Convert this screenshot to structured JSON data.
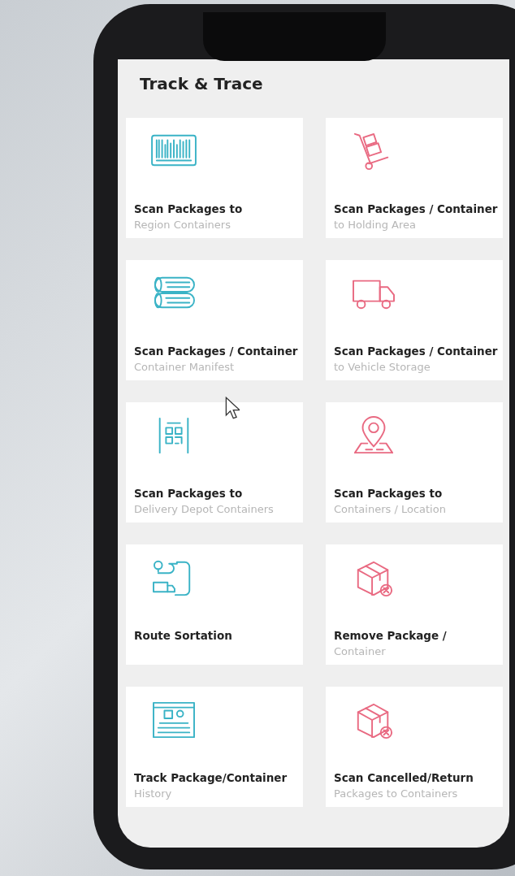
{
  "screen": {
    "title": "Track & Trace",
    "cards": [
      {
        "title": "Scan Packages to",
        "subtitle": "Region Containers",
        "color": "#3ab3c6"
      },
      {
        "title": "Scan Packages / Container",
        "subtitle": "to Holding Area",
        "color": "#e96a82"
      },
      {
        "title": "Scan Packages / Container",
        "subtitle": "Container Manifest",
        "color": "#3ab3c6"
      },
      {
        "title": "Scan Packages / Container",
        "subtitle": "to Vehicle Storage",
        "color": "#e96a82"
      },
      {
        "title": "Scan Packages to",
        "subtitle": "Delivery Depot Containers",
        "color": "#3ab3c6"
      },
      {
        "title": "Scan Packages to",
        "subtitle": "Containers / Location",
        "color": "#e96a82"
      },
      {
        "title": "Route Sortation",
        "color": "#3ab3c6"
      },
      {
        "title": "Remove Package /",
        "subtitle": "Container",
        "color": "#e96a82"
      },
      {
        "title": "Track Package/Container",
        "subtitle": "History",
        "color": "#3ab3c6"
      },
      {
        "title": "Scan Cancelled/Return",
        "subtitle": "Packages to Containers",
        "color": "#e96a82"
      }
    ]
  }
}
